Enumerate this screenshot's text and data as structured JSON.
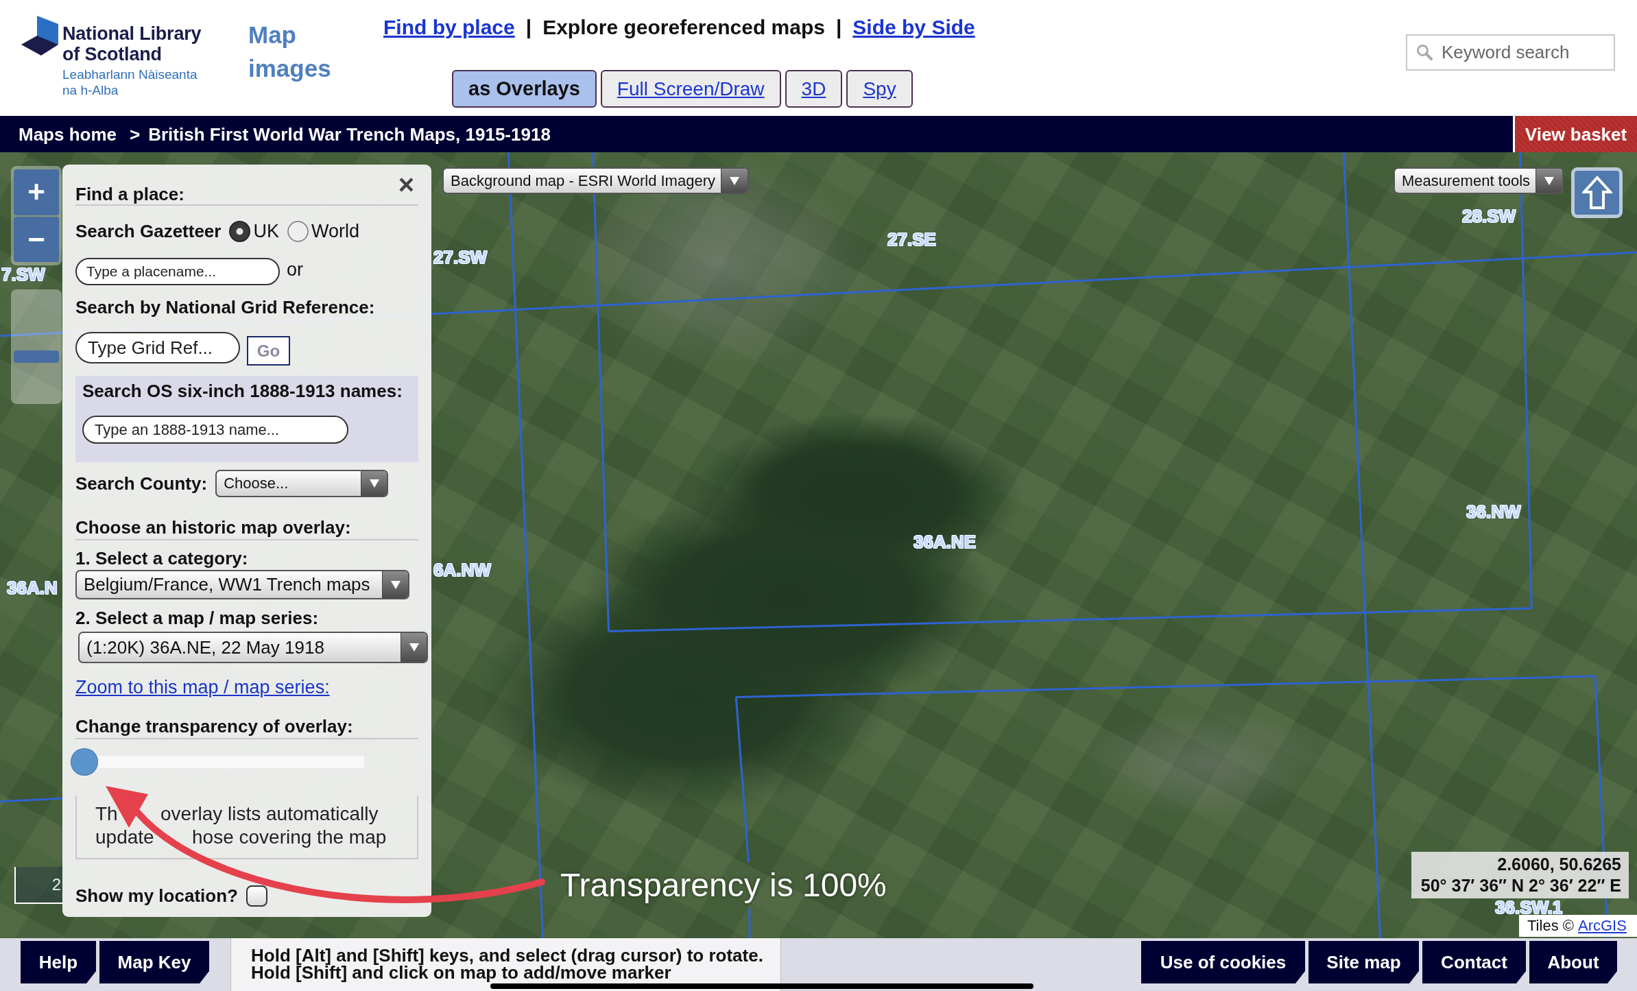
{
  "header": {
    "logo": {
      "title": "National Library of Scotland",
      "subtitle": "Leabharlann Nàiseanta na h-Alba"
    },
    "section_title": "Map images",
    "nav": {
      "separator": "|",
      "items": [
        {
          "label": "Find by place",
          "selected": false
        },
        {
          "label": "Explore georeferenced maps",
          "selected": true
        },
        {
          "label": "Side by Side",
          "selected": false
        }
      ]
    },
    "view_tabs": [
      {
        "label": "as Overlays",
        "selected": true
      },
      {
        "label": "Full Screen/Draw",
        "selected": false
      },
      {
        "label": "3D",
        "selected": false
      },
      {
        "label": "Spy",
        "selected": false
      }
    ],
    "search": {
      "placeholder": "Keyword search"
    }
  },
  "breadcrumb": {
    "separator": ">",
    "items": [
      "Maps home",
      "British First World War Trench Maps, 1915-1918"
    ],
    "basket_button": "View basket"
  },
  "map": {
    "zoom_buttons": [
      "+",
      "−"
    ],
    "zoom_slider": {
      "level": 0.4
    },
    "background_select": "Background map - ESRI World Imagery",
    "measurement_select": "Measurement tools",
    "grid_labels": [
      "7.SW",
      "27.SW",
      "27.SE",
      "28.SW",
      "36A.N",
      "6A.NW",
      "36A.NE",
      "36.NW",
      "36.SW.1"
    ],
    "scale_label": "2",
    "coordinates": [
      "2.6060, 50.6265",
      "50° 37′ 36″ N 2° 36′ 22″ E"
    ],
    "attribution": {
      "text": "Tiles ©",
      "link": "ArcGIS"
    }
  },
  "find_panel": {
    "title": "Find a place:",
    "close": "×",
    "gazetteer": {
      "label": "Search Gazetteer",
      "options": [
        {
          "label": "UK",
          "selected": true
        },
        {
          "label": "World",
          "selected": false
        }
      ]
    },
    "placename": {
      "placeholder": "Type a placename...",
      "suffix": "or"
    },
    "grid_ref": {
      "label": "Search by National Grid Reference:",
      "placeholder": "Type Grid Ref...",
      "button": "Go"
    },
    "os_names": {
      "label": "Search OS six-inch 1888-1913 names:",
      "placeholder": "Type an 1888-1913 name..."
    },
    "county": {
      "label": "Search County:",
      "value": "Choose..."
    },
    "overlay": {
      "title": "Choose an historic map overlay:",
      "category_label": "1. Select a category:",
      "category": "Belgium/France, WW1 Trench maps",
      "series_label": "2. Select a map / map series:",
      "series": "(1:20K) 36A.NE, 22 May 1918",
      "zoom_link": "Zoom to this map / map series:"
    },
    "transparency": {
      "label": "Change transparency of overlay:",
      "level": 0
    },
    "note": {
      "lines": [
        [
          "Th",
          "overlay lists automatically"
        ],
        [
          "update",
          "hose covering the map"
        ]
      ]
    },
    "location": {
      "label": "Show my location?",
      "checked": false
    }
  },
  "annotation": {
    "text": "Transparency is 100%"
  },
  "footer": {
    "left_buttons": [
      "Help",
      "Map Key"
    ],
    "hint_lines": [
      "Hold [Alt] and [Shift] keys, and select (drag cursor) to rotate.",
      "Hold [Shift] and click on map to add/move marker"
    ],
    "right_buttons": [
      "Use of cookies",
      "Site map",
      "Contact",
      "About"
    ]
  }
}
